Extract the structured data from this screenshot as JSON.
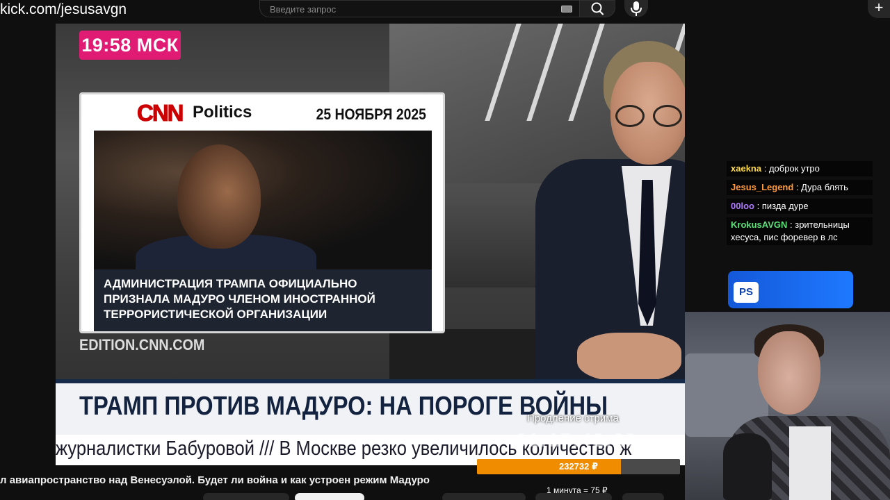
{
  "browser": {
    "channel_url": "kick.com/jesusavgn",
    "search_placeholder": "Введите запрос"
  },
  "video": {
    "time_badge": "19:58 МСК",
    "cnn_card": {
      "logo": "CNN",
      "section": "Politics",
      "date": "25 НОЯБРЯ 2025",
      "caption": "АДМИНИСТРАЦИЯ ТРАМПА ОФИЦИАЛЬНО ПРИЗНАЛА МАДУРО ЧЛЕНОМ ИНОСТРАННОЙ ТЕРРОРИСТИЧЕСКОЙ ОРГАНИЗАЦИИ"
    },
    "source_domain": "EDITION.CNN.COM",
    "headline": "ТРАМП ПРОТИВ МАДУРО: НА ПОРОГЕ ВОЙНЫ",
    "ticker": "журналистки Бабуровой   ///   В Москве резко увеличилось количество ж"
  },
  "stream_extension": {
    "label": "Продление стрима",
    "timer": "01:17:42:23",
    "amount": "232732 ₽",
    "progress_fraction": 0.71,
    "rate": "1 минута = 75 ₽",
    "bar_color": "#ef8c00"
  },
  "video_title": "л авиапространство над Венесуэлой. Будет ли война и как устроен режим Мадуро",
  "chat": {
    "messages": [
      {
        "user": "xaekna",
        "color": "#ffd84a",
        "text": "доброк утро"
      },
      {
        "user": "Jesus_Legend",
        "color": "#ff9a3c",
        "text": "Дура блять"
      },
      {
        "user": "00loo",
        "color": "#b07cff",
        "text": "пизда дуре"
      },
      {
        "user": "KrokusAVGN",
        "color": "#5ee07a",
        "text": "зрительницы хесуса, пис форевер в лс"
      }
    ]
  },
  "overlay": {
    "ps_logo": "PS",
    "brand_color": "#1e79ff"
  },
  "icons": [
    "search-icon",
    "microphone-icon",
    "keyboard-icon",
    "plus-icon"
  ]
}
